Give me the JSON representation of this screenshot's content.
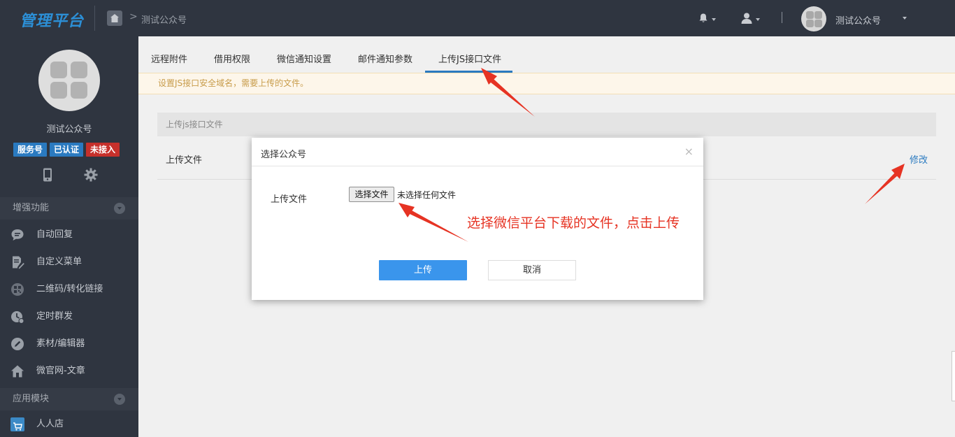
{
  "topbar": {
    "logo": "管理平台",
    "breadcrumb_sep": ">",
    "breadcrumb": "测试公众号",
    "account_name": "测试公众号",
    "icons": [
      "home-icon",
      "bell-icon",
      "user-icon",
      "chevron-down-icon"
    ]
  },
  "sidebar": {
    "account_name": "测试公众号",
    "badges": [
      "服务号",
      "已认证",
      "未接入"
    ],
    "icons": [
      "mobile-icon",
      "gear-icon"
    ],
    "section1": "增强功能",
    "menu": [
      {
        "label": "自动回复",
        "icon": "chat-icon"
      },
      {
        "label": "自定义菜单",
        "icon": "edit-doc-icon"
      },
      {
        "label": "二维码/转化链接",
        "icon": "qrcode-icon"
      },
      {
        "label": "定时群发",
        "icon": "clock-icon"
      },
      {
        "label": "素材/编辑器",
        "icon": "pencil-icon"
      },
      {
        "label": "微官网-文章",
        "icon": "home-icon"
      }
    ],
    "section2": "应用模块",
    "app": {
      "label": "人人店",
      "icon": "cart-icon"
    }
  },
  "tabs": [
    "远程附件",
    "借用权限",
    "微信通知设置",
    "邮件通知参数",
    "上传JS接口文件"
  ],
  "active_tab": "上传JS接口文件",
  "notice": "设置JS接口安全域名，需要上传的文件。",
  "panel": {
    "header": "上传js接口文件",
    "row_label": "上传文件",
    "edit_link": "修改"
  },
  "modal": {
    "title": "选择公众号",
    "close": "×",
    "field_label": "上传文件",
    "file_button": "选择文件",
    "file_status": "未选择任何文件",
    "upload_button": "上传",
    "cancel_button": "取消"
  },
  "annotation": {
    "hint": "选择微信平台下载的文件，点击上传",
    "color": "#e63323"
  },
  "colors": {
    "topbar": "#2f3540",
    "accent": "#2a7ac0",
    "primary_button": "#3a95ec",
    "badge_red": "#c6302b"
  }
}
